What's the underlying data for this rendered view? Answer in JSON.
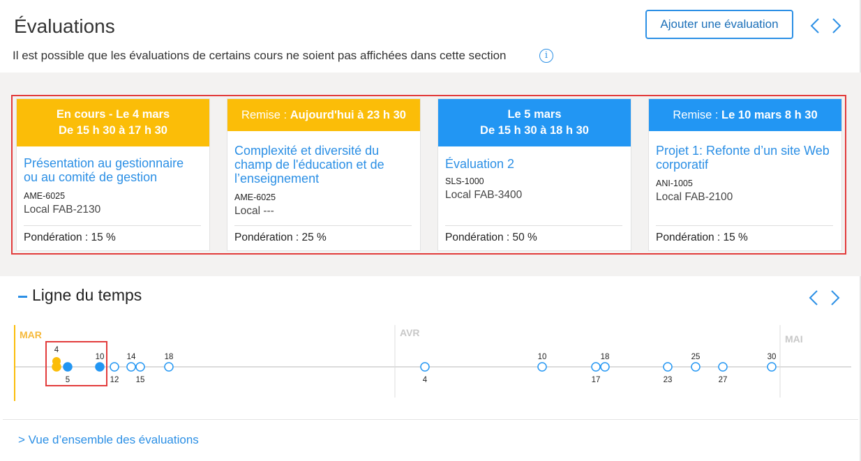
{
  "header": {
    "title": "Évaluations",
    "subtitle": "Il est possible que les évaluations de certains cours ne soient pas affichées dans cette section",
    "info_icon": "i",
    "add_button": "Ajouter une évaluation",
    "prev_icon": "chevron-left-icon",
    "next_icon": "chevron-right-icon"
  },
  "cards": [
    {
      "header_color": "#fbbd08",
      "header_line1": "En cours - Le 4 mars",
      "header_line2": "De 15 h 30 à 17 h 30",
      "title": "Présentation au gestionnaire ou au comité de gestion",
      "course": "AME-6025",
      "room": "Local FAB-2130",
      "weight": "Pondération : 15 %"
    },
    {
      "header_color": "#fbbd08",
      "header_prefix": "Remise : ",
      "header_value": "Aujourd'hui à 23 h 30",
      "title": "Complexité et diversité du champ de l'éducation et de l’enseignement",
      "course": "AME-6025",
      "room": "Local ---",
      "weight": "Pondération : 25 %"
    },
    {
      "header_color": "#2296f3",
      "header_line1": "Le 5 mars",
      "header_line2": "De 15 h 30 à 18 h 30",
      "title": "Évaluation 2",
      "course": "SLS-1000",
      "room": "Local FAB-3400",
      "weight": "Pondération : 50 %"
    },
    {
      "header_color": "#2296f3",
      "header_prefix": "Remise : ",
      "header_value": "Le 10 mars 8 h 30",
      "title": "Projet 1: Refonte d’un site Web corporatif",
      "course": "ANI-1005",
      "room": "Local FAB-2100",
      "weight": "Pondération : 15 %"
    }
  ],
  "timeline": {
    "title": "Ligne du temps",
    "months": [
      "MAR",
      "AVR",
      "MAI"
    ],
    "events": [
      {
        "month": "MAR",
        "day": 4,
        "label": "4",
        "label_pos": "above",
        "style": "filled",
        "color": "#fbbd08",
        "stacked": 2
      },
      {
        "month": "MAR",
        "day": 5,
        "label": "5",
        "label_pos": "below",
        "style": "filled",
        "color": "#2296f3"
      },
      {
        "month": "MAR",
        "day": 10,
        "label": "10",
        "label_pos": "above",
        "style": "filled",
        "color": "#2296f3"
      },
      {
        "month": "MAR",
        "day": 12,
        "label": "12",
        "label_pos": "below",
        "style": "outline",
        "color": "#2296f3"
      },
      {
        "month": "MAR",
        "day": 14,
        "label": "14",
        "label_pos": "above",
        "style": "outline",
        "color": "#2296f3"
      },
      {
        "month": "MAR",
        "day": 15,
        "label": "15",
        "label_pos": "below",
        "style": "outline",
        "color": "#2296f3"
      },
      {
        "month": "MAR",
        "day": 18,
        "label": "18",
        "label_pos": "above",
        "style": "outline",
        "color": "#2296f3"
      },
      {
        "month": "AVR",
        "day": 4,
        "label": "4",
        "label_pos": "below",
        "style": "outline",
        "color": "#2296f3"
      },
      {
        "month": "AVR",
        "day": 10,
        "label": "10",
        "label_pos": "above",
        "style": "outline",
        "color": "#2296f3"
      },
      {
        "month": "AVR",
        "day": 17,
        "label": "17",
        "label_pos": "below",
        "style": "outline",
        "color": "#2296f3"
      },
      {
        "month": "AVR",
        "day": 18,
        "label": "18",
        "label_pos": "above",
        "style": "outline",
        "color": "#2296f3"
      },
      {
        "month": "AVR",
        "day": 23,
        "label": "23",
        "label_pos": "below",
        "style": "outline",
        "color": "#2296f3"
      },
      {
        "month": "AVR",
        "day": 25,
        "label": "25",
        "label_pos": "above",
        "style": "outline",
        "color": "#2296f3"
      },
      {
        "month": "AVR",
        "day": 27,
        "label": "27",
        "label_pos": "below",
        "style": "outline",
        "color": "#2296f3"
      },
      {
        "month": "AVR",
        "day": 30,
        "label": "30",
        "label_pos": "above",
        "style": "outline",
        "color": "#2296f3"
      }
    ]
  },
  "footer": {
    "overview_link": "> Vue d’ensemble des évaluations"
  }
}
